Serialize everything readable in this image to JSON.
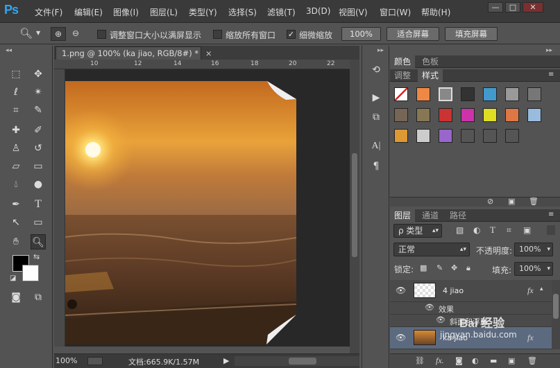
{
  "app": {
    "logo": "Ps"
  },
  "menu": [
    "文件(F)",
    "编辑(E)",
    "图像(I)",
    "图层(L)",
    "类型(Y)",
    "选择(S)",
    "滤镜(T)",
    "3D(D)",
    "视图(V)",
    "窗口(W)",
    "帮助(H)"
  ],
  "window_controls": {
    "minimize": "—",
    "maximize": "□",
    "close": "✕"
  },
  "options": {
    "resize_windows_label": "调整窗口大小以满屏显示",
    "zoom_all_label": "缩放所有窗口",
    "scrubby_zoom_label": "细微缩放",
    "zoom_100_button": "100%",
    "fit_screen_button": "适合屏幕",
    "fill_screen_button": "填充屏幕",
    "scrubby_checked": true
  },
  "document": {
    "tab_title": "1.png @ 100% (ka jiao, RGB/8#) *",
    "ruler_ticks": [
      "10",
      "12",
      "14",
      "16",
      "18",
      "20",
      "22"
    ]
  },
  "status": {
    "zoom": "100%",
    "doc_info": "文档:665.9K/1.57M"
  },
  "panels": {
    "color_tabs": [
      "颜色",
      "色板"
    ],
    "adjust_tabs": [
      "调整",
      "样式"
    ],
    "layer_tabs": [
      "图层",
      "通道",
      "路径"
    ],
    "filter_label": "ρ 类型",
    "blend_mode": "正常",
    "opacity_label": "不透明度:",
    "opacity_value": "100%",
    "lock_label": "锁定:",
    "fill_label": "填充:",
    "fill_value": "100%",
    "styles": [
      "#d23",
      "#e84",
      "#888",
      "#333",
      "#49c",
      "#999",
      "#777",
      "#765",
      "#875",
      "#c33",
      "#c3a",
      "#dd2",
      "#d74",
      "#9bd",
      "#d93",
      "#ccc",
      "#96c",
      "#555",
      "#555",
      "#555"
    ]
  },
  "layers": [
    {
      "name": "4 jiao",
      "fx": "fx",
      "effects_label": "效果",
      "effect_item": "斜面和浮雕"
    },
    {
      "name": "ka jiao",
      "fx": "fx"
    }
  ],
  "watermark": {
    "brand": "Bai 经验",
    "url": "jingyan.baidu.com"
  }
}
